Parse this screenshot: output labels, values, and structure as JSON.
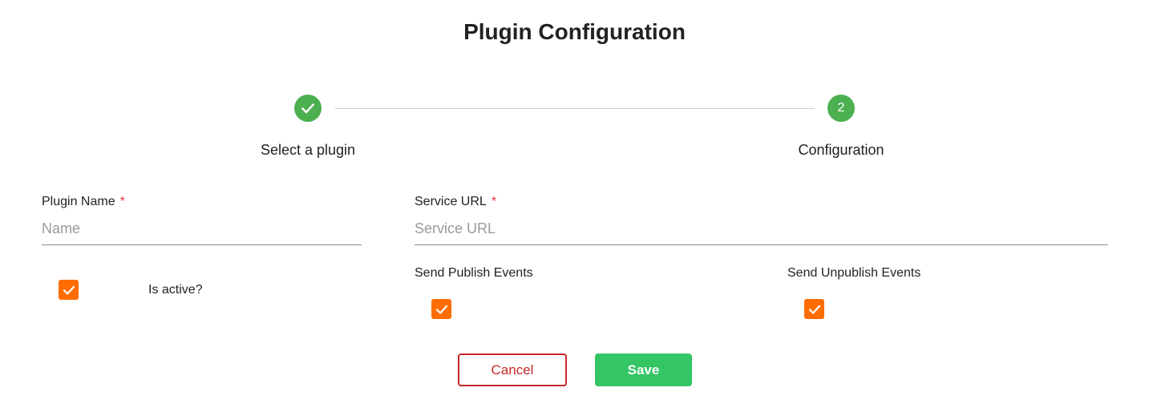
{
  "page": {
    "title": "Plugin Configuration"
  },
  "stepper": {
    "steps": [
      {
        "label": "Select a plugin",
        "status": "completed",
        "icon": "check-icon"
      },
      {
        "label": "Configuration",
        "status": "active",
        "number": "2"
      }
    ],
    "color": "#4caf50"
  },
  "form": {
    "plugin_name": {
      "label": "Plugin Name",
      "required_mark": "*",
      "value": "",
      "placeholder": "Name"
    },
    "service_url": {
      "label": "Service URL",
      "required_mark": "*",
      "value": "",
      "placeholder": "Service URL"
    },
    "is_active": {
      "label": "Is active?",
      "checked": true
    },
    "send_publish_events": {
      "label": "Send Publish Events",
      "checked": true
    },
    "send_unpublish_events": {
      "label": "Send Unpublish Events",
      "checked": true
    },
    "checkbox_color": "#ff6d00"
  },
  "actions": {
    "cancel_label": "Cancel",
    "save_label": "Save",
    "cancel_color": "#c62828",
    "save_color": "#34c565"
  }
}
